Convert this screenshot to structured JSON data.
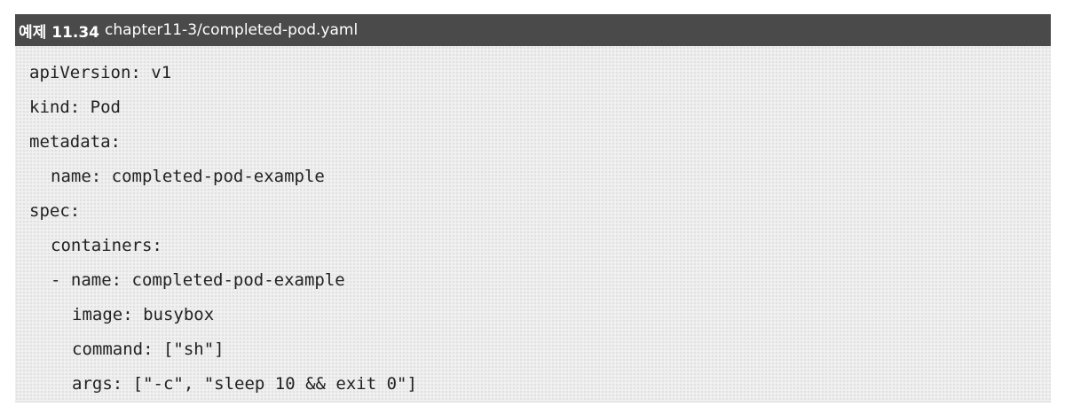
{
  "header": {
    "label": "예제 11.34",
    "filename": "chapter11-3/completed-pod.yaml"
  },
  "code": {
    "lines": [
      "apiVersion: v1",
      "kind: Pod",
      "metadata:",
      "name: completed-pod-example",
      "spec:",
      "containers:",
      "- name: completed-pod-example",
      "image: busybox",
      "command: [\"sh\"]",
      "args: [\"-c\", \"sleep 10 && exit 0\"]"
    ]
  },
  "colors": {
    "header_bg": "#4a4a4a",
    "header_text": "#ffffff",
    "code_bg": "#f1f1f1",
    "code_text": "#222222"
  }
}
